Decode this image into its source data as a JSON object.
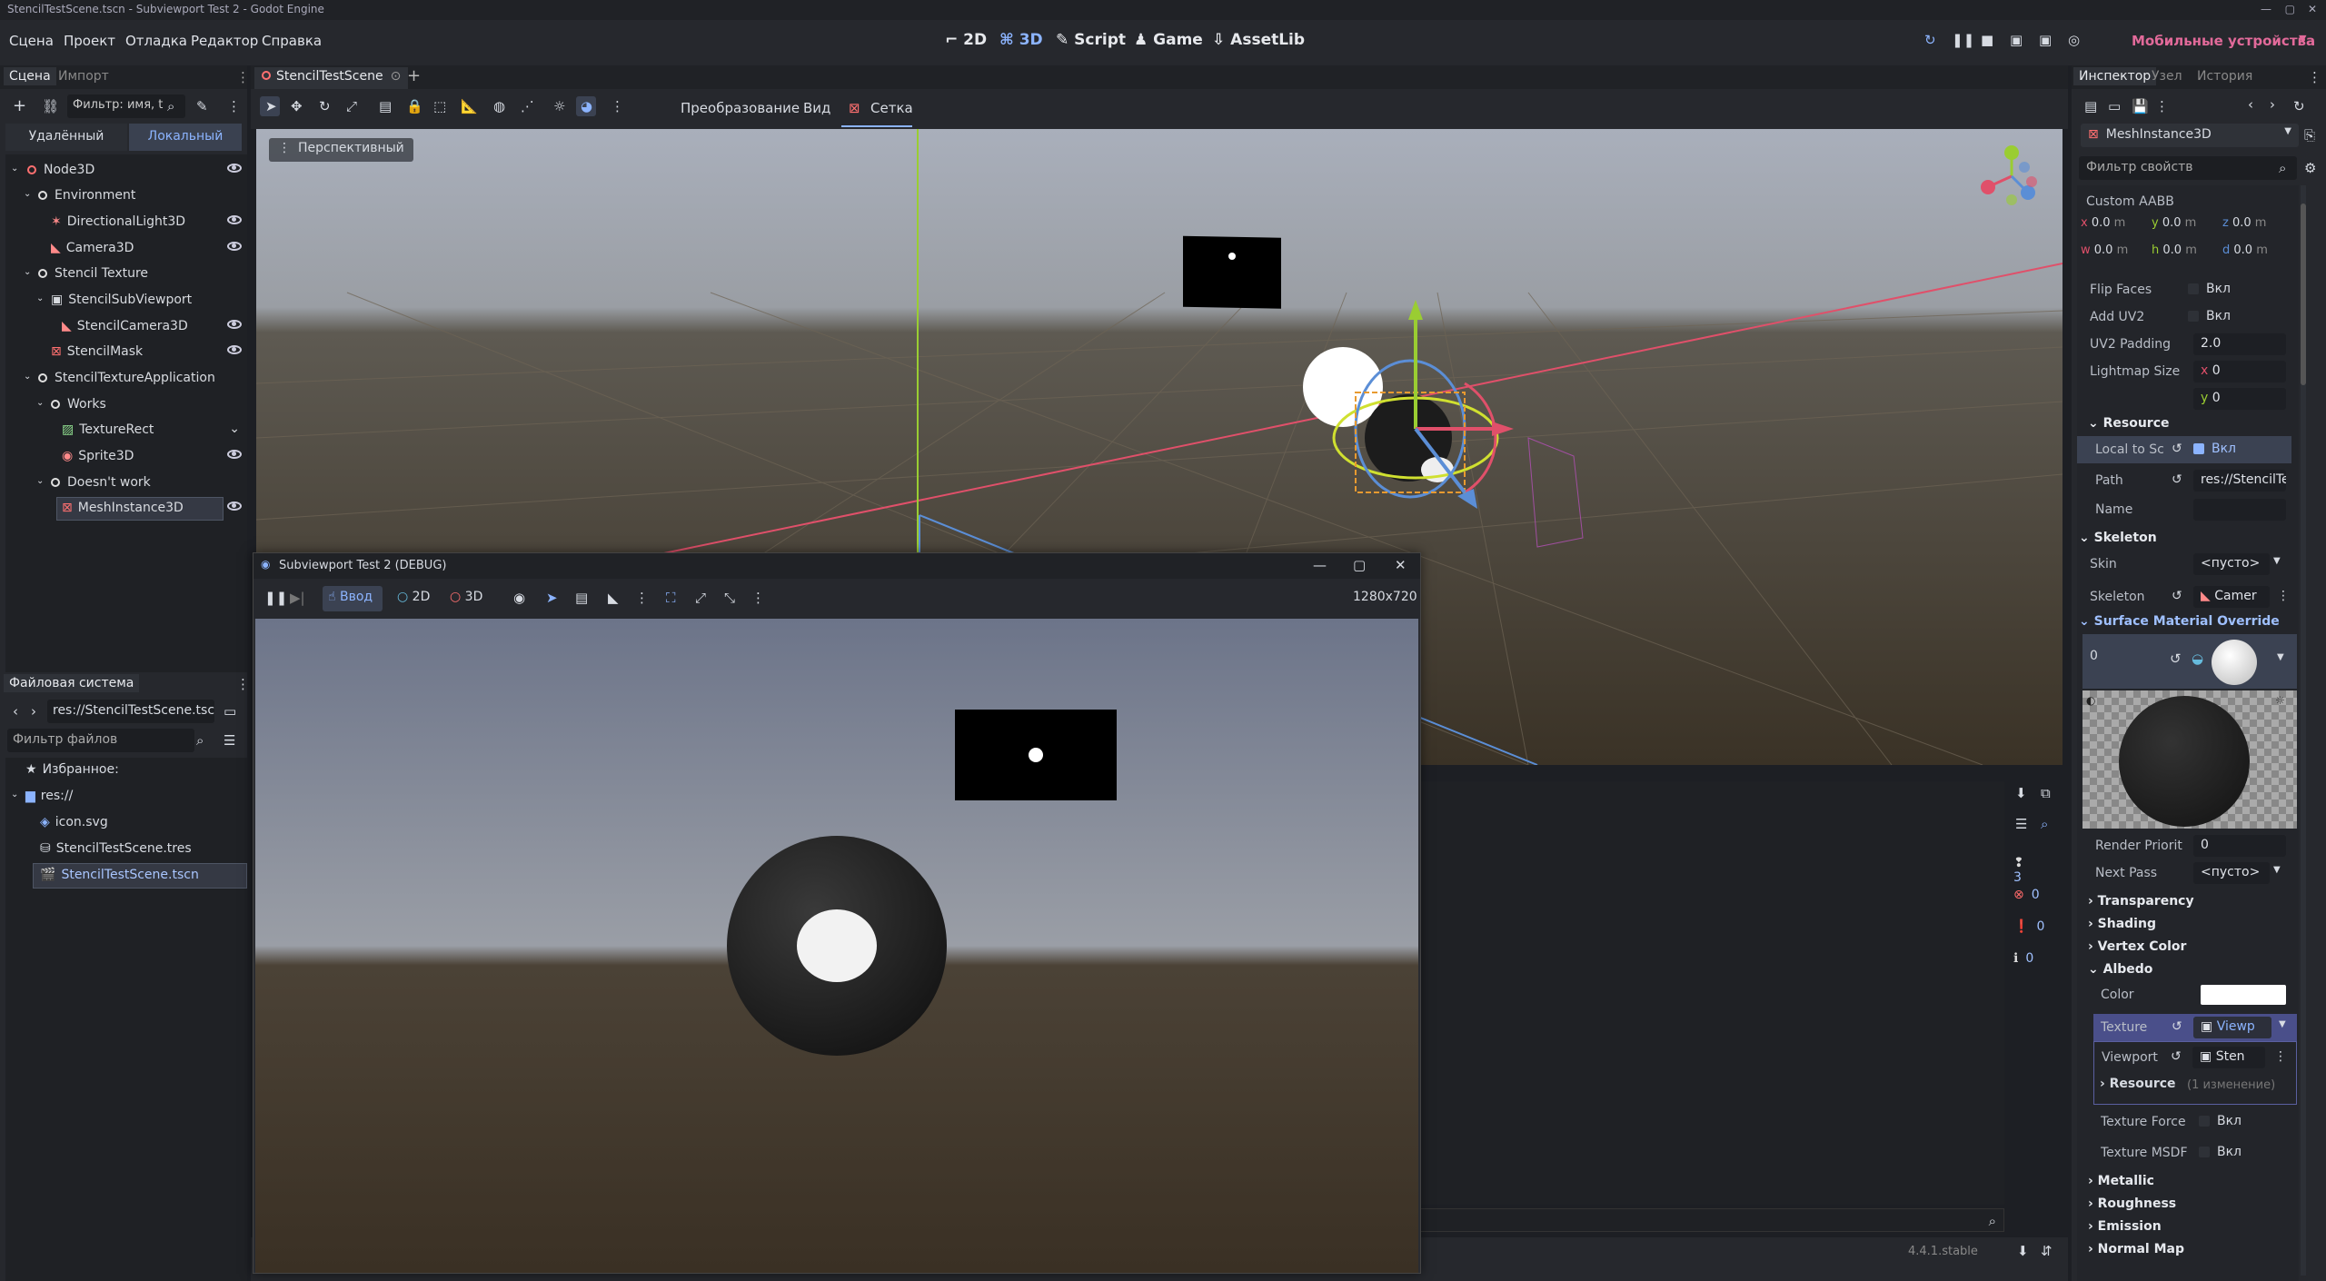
{
  "os_title": "StencilTestScene.tscn - Subviewport Test 2 - Godot Engine",
  "menu": [
    "Сцена",
    "Проект",
    "Отладка",
    "Редактор",
    "Справка"
  ],
  "modes": [
    "2D",
    "3D",
    "Script",
    "Game",
    "AssetLib"
  ],
  "mobile_label": "Мобильные устройства",
  "scene_panel": {
    "tabs": [
      "Сцена",
      "Импорт"
    ],
    "filter_placeholder": "Фильтр: имя, t",
    "remote": "Удалённый",
    "local": "Локальный",
    "nodes": [
      "Node3D",
      "Environment",
      "DirectionalLight3D",
      "Camera3D",
      "Stencil Texture",
      "StencilSubViewport",
      "StencilCamera3D",
      "StencilMask",
      "StencilTextureApplication",
      "Works",
      "TextureRect",
      "Sprite3D",
      "Doesn't work",
      "MeshInstance3D"
    ]
  },
  "filesystem": {
    "title": "Файловая система",
    "path": "res://StencilTestScene.tsc",
    "filter_placeholder": "Фильтр файлов",
    "fav": "Избранное:",
    "root": "res://",
    "files": [
      "icon.svg",
      "StencilTestScene.tres",
      "StencilTestScene.tscn"
    ]
  },
  "scene_tab": "StencilTestScene",
  "viewport_menu": {
    "transform": "Преобразование",
    "view": "Вид",
    "grid": "Сетка",
    "perspective": "Перспективный"
  },
  "debug_window": {
    "title": "Subviewport Test 2 (DEBUG)",
    "input": "Ввод",
    "d2": "2D",
    "d3": "3D",
    "resolution": "1280x720"
  },
  "output_counts": [
    "3",
    "0",
    "0",
    "0"
  ],
  "version": "4.4.1.stable",
  "inspector": {
    "tabs": [
      "Инспектор",
      "Узел",
      "История"
    ],
    "node": "MeshInstance3D",
    "filter_placeholder": "Фильтр свойств",
    "custom_aabb": "Custom AABB",
    "aabb": {
      "x": "0.0",
      "y": "0.0",
      "z": "0.0",
      "w": "0.0",
      "h": "0.0",
      "d": "0.0"
    },
    "unit": "m",
    "flip_faces": "Flip Faces",
    "add_uv2": "Add UV2",
    "on": "Вкл",
    "uv2_padding": "UV2 Padding",
    "uv2_padding_val": "2.0",
    "lightmap_size": "Lightmap Size",
    "lm_x": "0",
    "lm_y": "0",
    "resource": "Resource",
    "local_to_scene": "Local to Sc",
    "path": "Path",
    "path_val": "res://StencilTe",
    "name": "Name",
    "skeleton_sect": "Skeleton",
    "skin": "Skin",
    "empty": "<пусто>",
    "skeleton": "Skeleton",
    "skeleton_val": "Camer",
    "surface_override": "Surface Material Override",
    "slot": "0",
    "render_priority": "Render Priorit",
    "render_priority_val": "0",
    "next_pass": "Next Pass",
    "groups": [
      "Transparency",
      "Shading",
      "Vertex Color",
      "Albedo"
    ],
    "color": "Color",
    "texture": "Texture",
    "texture_val": "Viewp",
    "viewport": "Viewport",
    "viewport_val": "Sten",
    "resource_sub": "Resource",
    "changes": "(1 изменение)",
    "texture_force": "Texture Force",
    "texture_msdf": "Texture MSDF",
    "groups2": [
      "Metallic",
      "Roughness",
      "Emission",
      "Normal Map"
    ]
  }
}
